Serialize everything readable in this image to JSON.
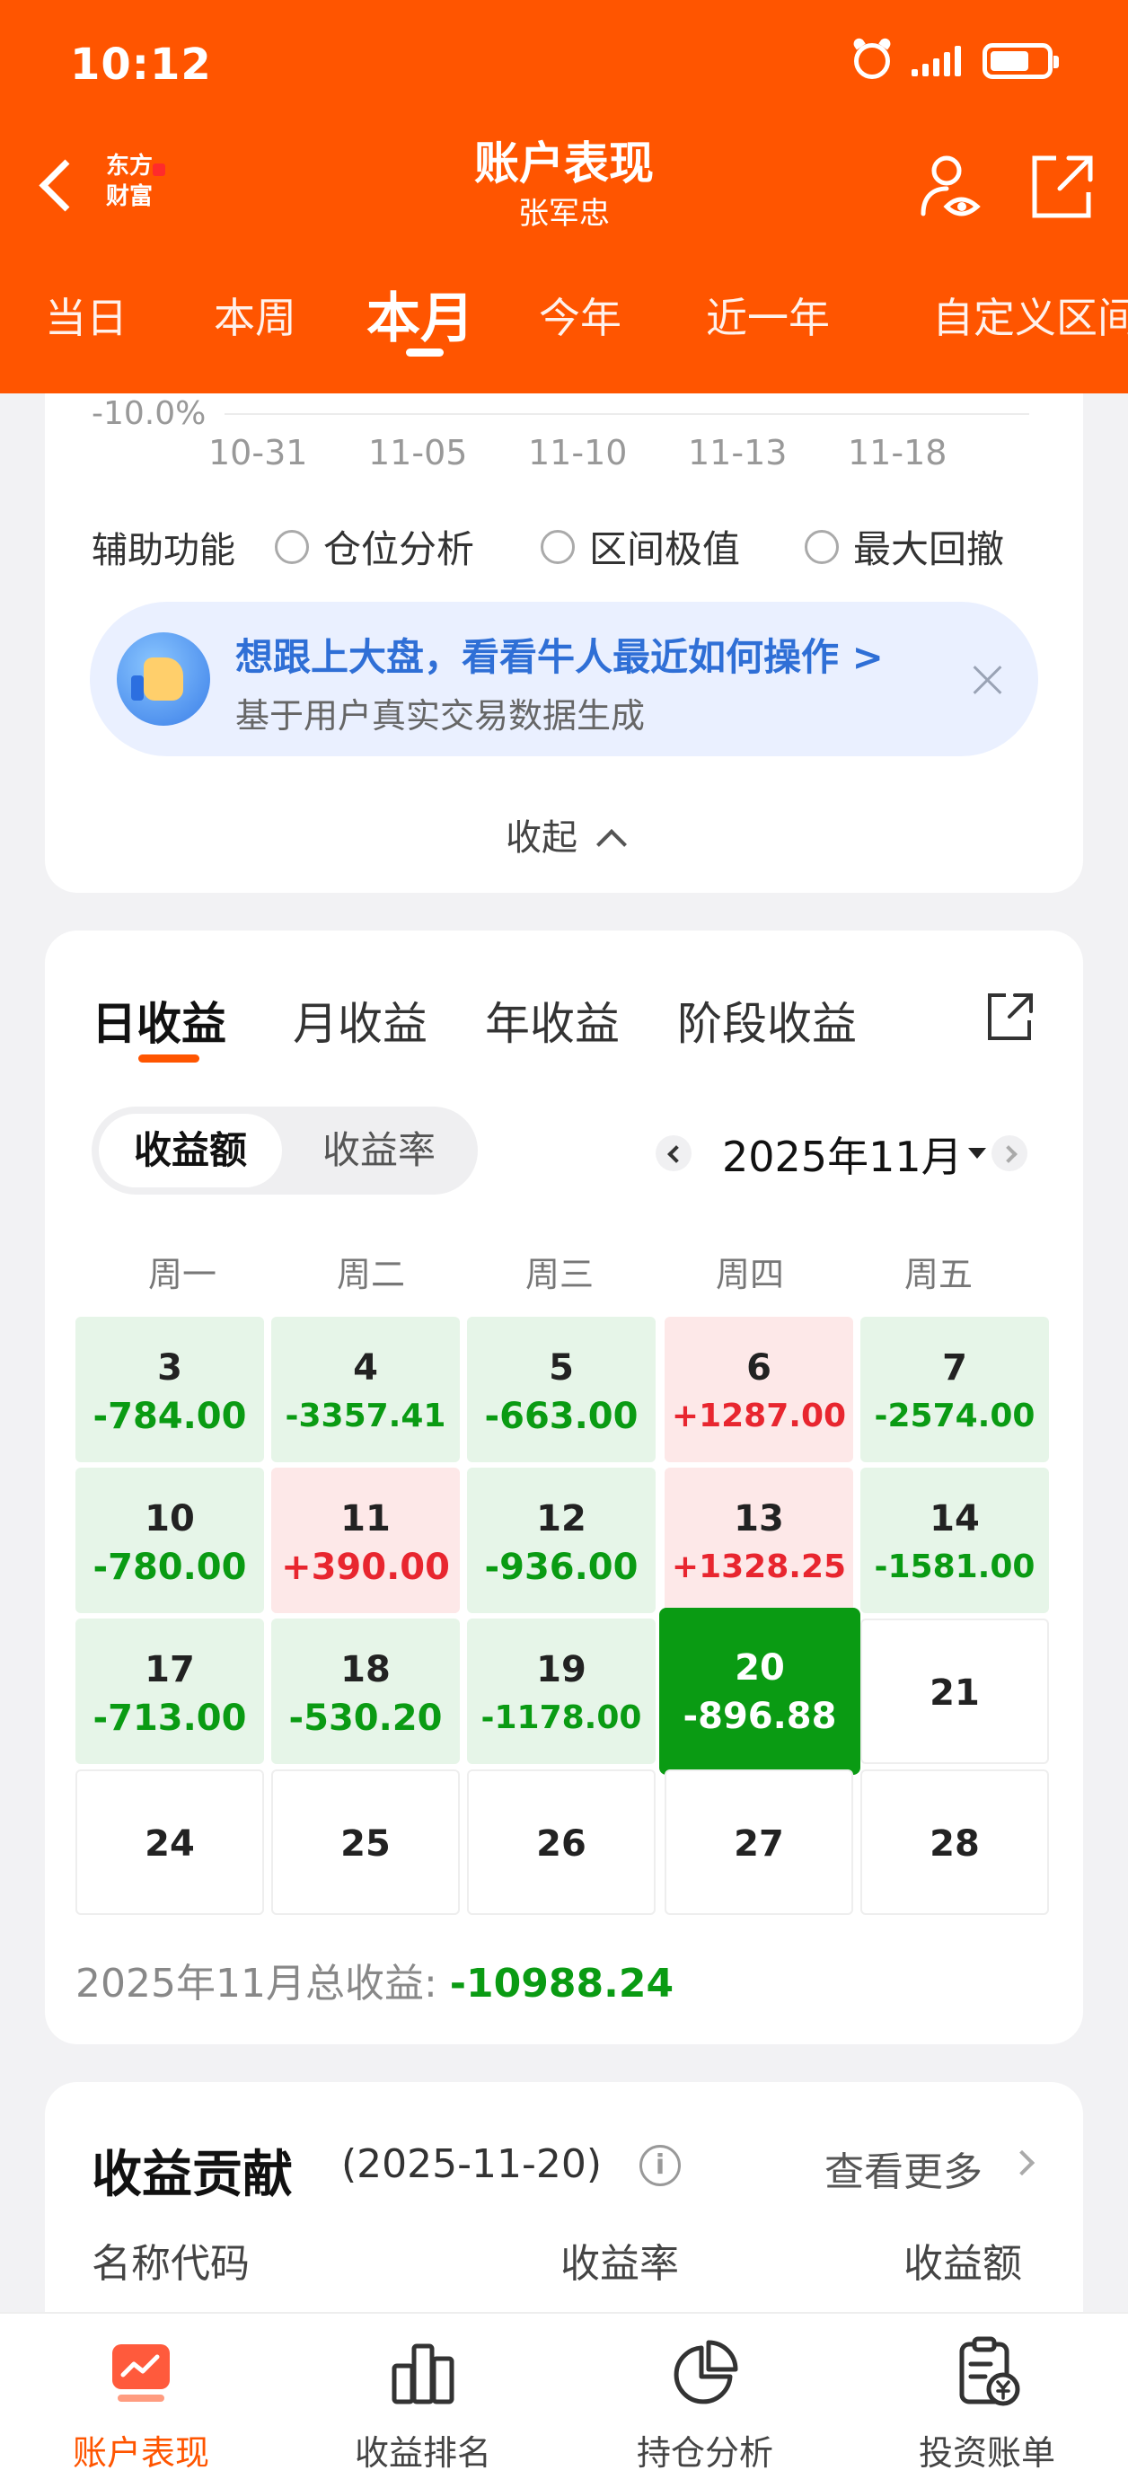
{
  "status_bar": {
    "time": "10:12"
  },
  "header": {
    "title": "账户表现",
    "subtitle": "张军忠",
    "logo_text": [
      "东方",
      "财富"
    ],
    "colors": {
      "brand": "#ff5500"
    }
  },
  "range_tabs": [
    "当日",
    "本周",
    "本月",
    "今年",
    "近一年",
    "自定义区间"
  ],
  "chart": {
    "y_label": "-10.0%",
    "x_ticks": [
      "10-31",
      "11-05",
      "11-10",
      "11-13",
      "11-18"
    ]
  },
  "helpers": {
    "label": "辅助功能",
    "options": [
      "仓位分析",
      "区间极值",
      "最大回撤"
    ]
  },
  "promo": {
    "title": "想跟上大盘，看看牛人最近如何操作 >",
    "subtitle": "基于用户真实交易数据生成"
  },
  "collapse_label": "收起",
  "earnings": {
    "tabs": [
      "日收益",
      "月收益",
      "年收益",
      "阶段收益"
    ],
    "toggle": [
      "收益额",
      "收益率"
    ],
    "month": "2025年11月",
    "weekdays": [
      "周一",
      "周二",
      "周三",
      "周四",
      "周五"
    ],
    "days": [
      {
        "day": "3",
        "value": "-784.00"
      },
      {
        "day": "4",
        "value": "-3357.41"
      },
      {
        "day": "5",
        "value": "-663.00"
      },
      {
        "day": "6",
        "value": "+1287.00"
      },
      {
        "day": "7",
        "value": "-2574.00"
      },
      {
        "day": "10",
        "value": "-780.00"
      },
      {
        "day": "11",
        "value": "+390.00"
      },
      {
        "day": "12",
        "value": "-936.00"
      },
      {
        "day": "13",
        "value": "+1328.25"
      },
      {
        "day": "14",
        "value": "-1581.00"
      },
      {
        "day": "17",
        "value": "-713.00"
      },
      {
        "day": "18",
        "value": "-530.20"
      },
      {
        "day": "19",
        "value": "-1178.00"
      },
      {
        "day": "20",
        "value": "-896.88"
      },
      {
        "day": "21",
        "value": ""
      },
      {
        "day": "24",
        "value": ""
      },
      {
        "day": "25",
        "value": ""
      },
      {
        "day": "26",
        "value": ""
      },
      {
        "day": "27",
        "value": ""
      },
      {
        "day": "28",
        "value": ""
      }
    ],
    "total_label": "2025年11月总收益:",
    "total_value": "-10988.24"
  },
  "contribution": {
    "title": "收益贡献",
    "date": "(2025-11-20)",
    "more": "查看更多",
    "columns": [
      "名称代码",
      "收益率",
      "收益额"
    ]
  },
  "bottom_nav": [
    {
      "label": "账户表现",
      "icon": "chart-monitor-icon"
    },
    {
      "label": "收益排名",
      "icon": "bar-ranking-icon"
    },
    {
      "label": "持仓分析",
      "icon": "pie-chart-icon"
    },
    {
      "label": "投资账单",
      "icon": "bill-icon"
    }
  ]
}
